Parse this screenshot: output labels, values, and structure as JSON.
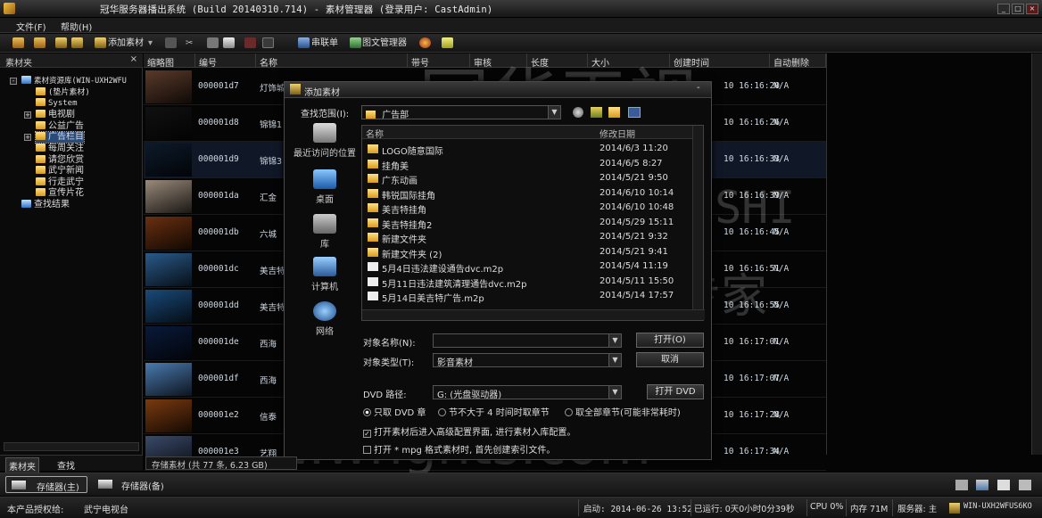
{
  "window": {
    "title": "冠华服务器播出系统 (Build 20140310.714) - 素材管理器 (登录用户: CastAdmin)",
    "app_icon": "app-icon",
    "controls": [
      "minimize-icon",
      "maximize-icon",
      "close-icon"
    ]
  },
  "menu": [
    "文件(F)",
    "帮助(H)"
  ],
  "toolbar": {
    "add_material": "添加素材",
    "sequence": "串联单",
    "graphic_manager": "图文管理器"
  },
  "sidebar": {
    "header": "素材夹",
    "close": "×",
    "tree": [
      {
        "label": "素材资源库(WIN-UXH2WFU",
        "icon": "computer-icon",
        "level": 0,
        "toggle": "-"
      },
      {
        "label": "(垫片素材)",
        "icon": "folder-icon",
        "level": 1
      },
      {
        "label": "System",
        "icon": "folder-icon",
        "level": 1
      },
      {
        "label": "电视剧",
        "icon": "folder-icon",
        "level": 1,
        "toggle": "+"
      },
      {
        "label": "公益广告",
        "icon": "folder-icon",
        "level": 1
      },
      {
        "label": "广告栏目",
        "icon": "folder-icon",
        "level": 1,
        "toggle": "+",
        "selected": true
      },
      {
        "label": "每周关注",
        "icon": "folder-icon",
        "level": 1
      },
      {
        "label": "请您欣赏",
        "icon": "folder-icon",
        "level": 1
      },
      {
        "label": "武宁新闻",
        "icon": "folder-icon",
        "level": 1
      },
      {
        "label": "行走武宁",
        "icon": "folder-icon",
        "level": 1
      },
      {
        "label": "宣传片花",
        "icon": "folder-icon",
        "level": 1
      },
      {
        "label": "查找结果",
        "icon": "search-folder-icon",
        "level": 0
      }
    ],
    "tabs": [
      "素材夹",
      "查找"
    ]
  },
  "grid": {
    "columns": [
      "缩略图",
      "编号",
      "名称",
      "带号",
      "审核",
      "长度",
      "大小",
      "创建时间",
      "自动删除"
    ],
    "rows": [
      {
        "id": "000001d7",
        "name": "灯饰城",
        "created": "10 16:16:20",
        "autodel": "N/A"
      },
      {
        "id": "000001d8",
        "name": "锦锦1",
        "created": "10 16:16:26",
        "autodel": "N/A"
      },
      {
        "id": "000001d9",
        "name": "锦锦3",
        "created": "10 16:16:33",
        "autodel": "N/A"
      },
      {
        "id": "000001da",
        "name": "汇金",
        "created": "10 16:16:39",
        "autodel": "N/A"
      },
      {
        "id": "000001db",
        "name": "六城",
        "created": "10 16:16:45",
        "autodel": "N/A"
      },
      {
        "id": "000001dc",
        "name": "美吉特",
        "created": "10 16:16:51",
        "autodel": "N/A"
      },
      {
        "id": "000001dd",
        "name": "美吉特",
        "created": "10 16:16:55",
        "autodel": "N/A"
      },
      {
        "id": "000001de",
        "name": "西海",
        "created": "10 16:17:01",
        "autodel": "N/A"
      },
      {
        "id": "000001df",
        "name": "西海",
        "created": "10 16:17:07",
        "autodel": "N/A"
      },
      {
        "id": "000001e2",
        "name": "信泰",
        "created": "10 16:17:28",
        "autodel": "N/A"
      },
      {
        "id": "000001e3",
        "name": "艺翔",
        "created": "10 16:17:34",
        "autodel": "N/A"
      }
    ],
    "footer_tab": "存储素材 (共 77 条, 6.23 GB)"
  },
  "dialog": {
    "title": "添加素材",
    "lookin_label": "查找范围(I):",
    "lookin_value": "广告部",
    "places": [
      "最近访问的位置",
      "桌面",
      "库",
      "计算机",
      "网络"
    ],
    "list_headers": [
      "名称",
      "修改日期"
    ],
    "files": [
      {
        "name": "LOGO随意国际",
        "date": "2014/6/3 11:20",
        "type": "folder"
      },
      {
        "name": "挂角美",
        "date": "2014/6/5 8:27",
        "type": "folder"
      },
      {
        "name": "广东动画",
        "date": "2014/5/21 9:50",
        "type": "folder"
      },
      {
        "name": "韩锐国际挂角",
        "date": "2014/6/10 10:14",
        "type": "folder"
      },
      {
        "name": "美吉特挂角",
        "date": "2014/6/10 10:48",
        "type": "folder"
      },
      {
        "name": "美吉特挂角2",
        "date": "2014/5/29 15:11",
        "type": "folder"
      },
      {
        "name": "新建文件夹",
        "date": "2014/5/21 9:32",
        "type": "folder"
      },
      {
        "name": "新建文件夹 (2)",
        "date": "2014/5/21 9:41",
        "type": "folder"
      },
      {
        "name": "5月4日违法建设通告dvc.m2p",
        "date": "2014/5/4 11:19",
        "type": "file"
      },
      {
        "name": "5月11日违法建筑清理通告dvc.m2p",
        "date": "2014/5/11 15:50",
        "type": "file"
      },
      {
        "name": "5月14日美吉特广告.m2p",
        "date": "2014/5/14 17:57",
        "type": "file"
      }
    ],
    "obj_name_label": "对象名称(N):",
    "obj_name_value": "",
    "obj_type_label": "对象类型(T):",
    "obj_type_value": "影音素材",
    "open_btn": "打开(O)",
    "cancel_btn": "取消",
    "dvd_label": "DVD 路径:",
    "dvd_value": "G: (光盘驱动器)",
    "open_dvd_btn": "打开 DVD",
    "radio1": "只取 DVD 章",
    "radio2": "节不大于 4 时间时取章节",
    "radio3": "取全部章节(可能非常耗时)",
    "check1": "打开素材后进入高级配置界面, 进行素材入库配置。",
    "check2": "打开 * mpg 格式素材时, 首先创建索引文件。"
  },
  "storage": {
    "main": "存储器(主)",
    "backup": "存储器(备)"
  },
  "status": {
    "license_label": "本产品授权给:",
    "license_value": "武宁电视台",
    "start": "启动: 2014-06-26 13:52",
    "running": "已运行: 0天0小时0分39秒",
    "cpu": "CPU 0%",
    "mem": "内存 71M",
    "server_label": "服务器: 主",
    "server_name": "WIN-UXH2WFUS6KO"
  },
  "watermark": {
    "cn": "冠华天视",
    "en": "GUANHUATIANSHI",
    "cn2": "音视频专家",
    "url": "http://www.whghts.com"
  }
}
